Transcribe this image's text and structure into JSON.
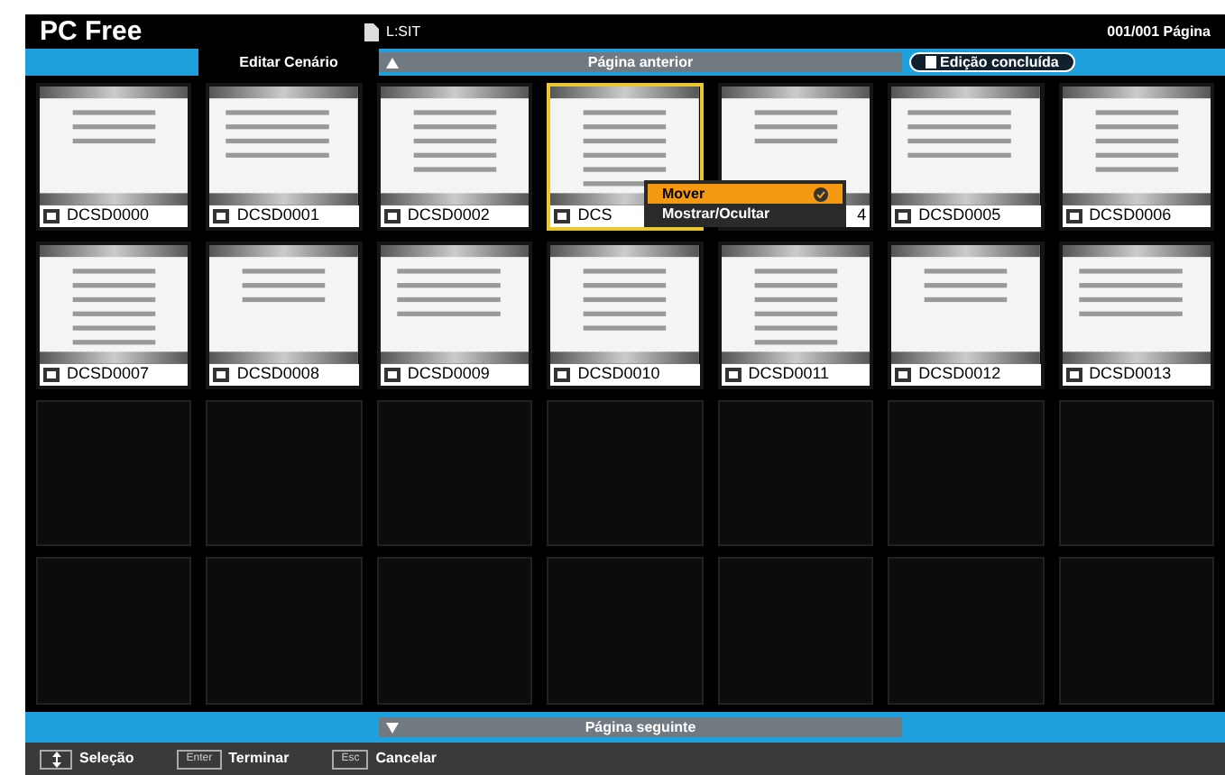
{
  "header": {
    "title": "PC Free",
    "source": "L:SIT",
    "page": "001/001 Página"
  },
  "toolbar": {
    "mode_tab": "Editar Cenário",
    "prev_page": "Página anterior",
    "done_button": "Edição concluída"
  },
  "slides": [
    {
      "label": "DCSD0000",
      "selected": false
    },
    {
      "label": "DCSD0001",
      "selected": false
    },
    {
      "label": "DCSD0002",
      "selected": false
    },
    {
      "label": "DCS",
      "selected": true
    },
    {
      "label": "4",
      "selected": false,
      "covered_left": true
    },
    {
      "label": "DCSD0005",
      "selected": false
    },
    {
      "label": "DCSD0006",
      "selected": false
    },
    {
      "label": "DCSD0007",
      "selected": false
    },
    {
      "label": "DCSD0008",
      "selected": false
    },
    {
      "label": "DCSD0009",
      "selected": false
    },
    {
      "label": "DCSD0010",
      "selected": false
    },
    {
      "label": "DCSD0011",
      "selected": false
    },
    {
      "label": "DCSD0012",
      "selected": false
    },
    {
      "label": "DCSD0013",
      "selected": false
    }
  ],
  "context_menu": {
    "items": [
      {
        "label": "Mover",
        "selected": true
      },
      {
        "label": "Mostrar/Ocultar",
        "selected": false
      }
    ]
  },
  "next_page": "Página seguinte",
  "footer": [
    {
      "label": "Seleção"
    },
    {
      "key": "Enter",
      "label": "Terminar"
    },
    {
      "key": "Esc",
      "label": "Cancelar"
    }
  ]
}
